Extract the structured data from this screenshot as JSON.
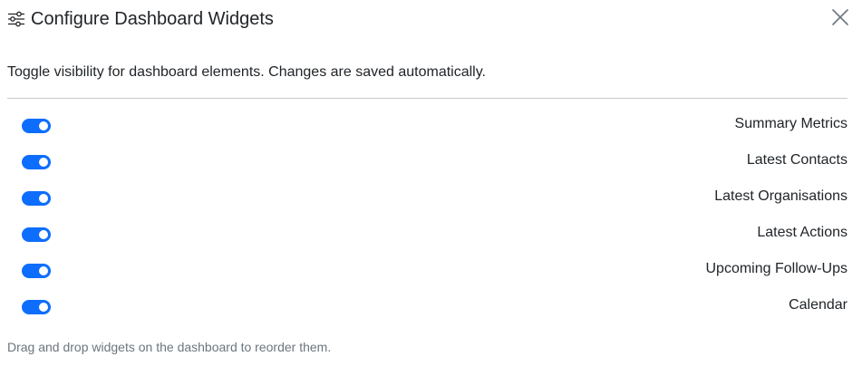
{
  "dialog": {
    "title": "Configure Dashboard Widgets",
    "title_icon": "sliders-icon",
    "close_icon": "close-icon",
    "description": "Toggle visibility for dashboard elements. Changes are saved automatically.",
    "footer_note": "Drag and drop widgets on the dashboard to reorder them."
  },
  "colors": {
    "toggle_on": "#0d6efd",
    "text": "#212529",
    "muted": "#6c757d",
    "divider": "#c8cbcf"
  },
  "widgets": [
    {
      "label": "Summary Metrics",
      "enabled": true
    },
    {
      "label": "Latest Contacts",
      "enabled": true
    },
    {
      "label": "Latest Organisations",
      "enabled": true
    },
    {
      "label": "Latest Actions",
      "enabled": true
    },
    {
      "label": "Upcoming Follow-Ups",
      "enabled": true
    },
    {
      "label": "Calendar",
      "enabled": true
    }
  ]
}
